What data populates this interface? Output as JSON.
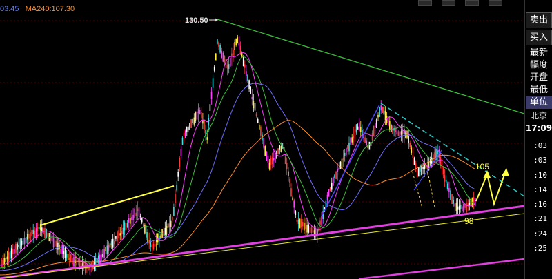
{
  "legend": {
    "prev_ma": "03.45",
    "ma240": "MA240:107.30"
  },
  "annotations": {
    "high_label": "130.50",
    "target_up": "105",
    "target_down": "98"
  },
  "side_panel": {
    "buttons": [
      "卖出",
      "买入",
      "最新",
      "幅度",
      "开盘",
      "最低",
      "单位"
    ],
    "selected": "单位",
    "city": "北京",
    "time": "17:09",
    "ticks": [
      ":03",
      ":03",
      ":10",
      ":14",
      ":16",
      ":21",
      ":24",
      ":25"
    ]
  },
  "colors": {
    "background": "#000000",
    "up_candle": "#ff3a3a",
    "ma_orange": "#ff8c2a",
    "ma_blue": "#5a7cff",
    "trend_green": "#3cc03c",
    "support_magenta": "#e040e0",
    "support_yellow": "#ffff40"
  }
}
